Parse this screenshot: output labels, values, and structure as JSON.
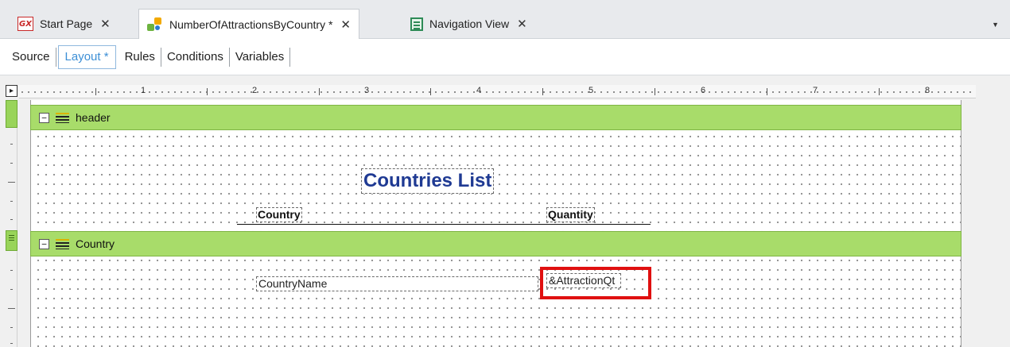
{
  "tabs": [
    {
      "label": "Start Page",
      "icon": "gx-logo-icon",
      "icon_text": "GX",
      "close": "✕",
      "active": false
    },
    {
      "label": "NumberOfAttractionsByCountry *",
      "icon": "procedure-icon",
      "close": "✕",
      "active": true
    },
    {
      "label": "Navigation View",
      "icon": "navigation-view-icon",
      "close": "✕",
      "active": false
    }
  ],
  "tabstrip_menu": "▼",
  "subtabs": [
    {
      "label": "Source",
      "active": false
    },
    {
      "label": "Layout *",
      "active": true
    },
    {
      "label": "Rules",
      "active": false
    },
    {
      "label": "Conditions",
      "active": false
    },
    {
      "label": "Variables",
      "active": false
    }
  ],
  "ruler": {
    "corner": "▸",
    "numbers": [
      "1",
      "2",
      "3",
      "4",
      "5",
      "6",
      "7",
      "8"
    ]
  },
  "bands": [
    {
      "name": "header",
      "collapse": "−"
    },
    {
      "name": "Country",
      "collapse": "−"
    }
  ],
  "controls": {
    "title": "Countries List",
    "col_country": "Country",
    "col_quantity": "Quantity",
    "field_country_name": "CountryName",
    "field_attraction_qty": "&AttractionQt"
  },
  "colors": {
    "band_green": "#a8dc6a",
    "title_blue": "#1f3a93",
    "active_tab_blue": "#3d8fd6",
    "highlight_red": "#e01010"
  }
}
